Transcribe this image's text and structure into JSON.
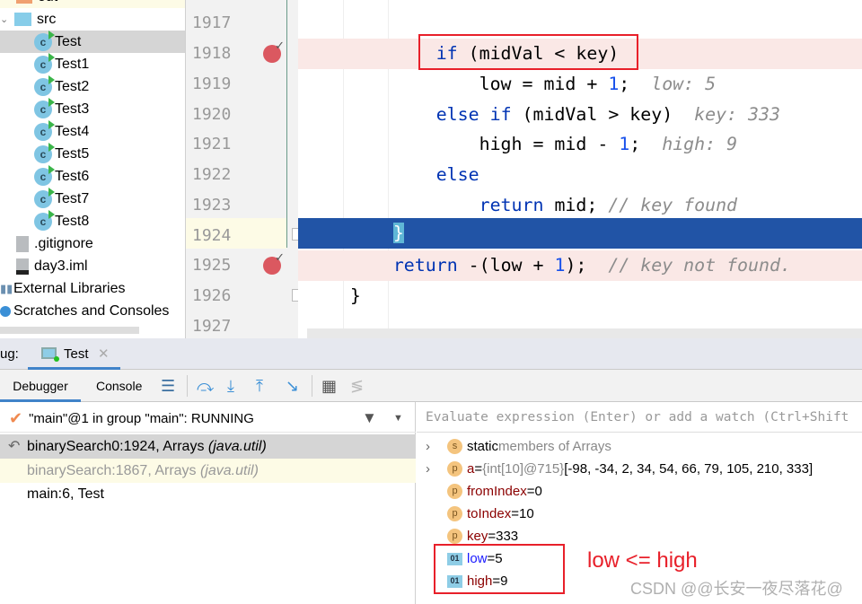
{
  "project_tree": {
    "items": [
      {
        "label": "out",
        "type": "folder"
      },
      {
        "label": "src",
        "type": "folder"
      },
      {
        "label": "Test",
        "type": "class",
        "selected": true
      },
      {
        "label": "Test1",
        "type": "class"
      },
      {
        "label": "Test2",
        "type": "class"
      },
      {
        "label": "Test3",
        "type": "class"
      },
      {
        "label": "Test4",
        "type": "class"
      },
      {
        "label": "Test5",
        "type": "class"
      },
      {
        "label": "Test6",
        "type": "class"
      },
      {
        "label": "Test7",
        "type": "class"
      },
      {
        "label": "Test8",
        "type": "class"
      },
      {
        "label": ".gitignore",
        "type": "file"
      },
      {
        "label": "day3.iml",
        "type": "file"
      },
      {
        "label": "External Libraries",
        "type": "libraries"
      },
      {
        "label": "Scratches and Consoles",
        "type": "scratches"
      }
    ]
  },
  "editor": {
    "line_numbers": [
      "1917",
      "1918",
      "1919",
      "1920",
      "1921",
      "1922",
      "1923",
      "1924",
      "1925",
      "1926",
      "1927"
    ],
    "lines": {
      "l1918": {
        "kw": "if",
        "rest": " (midVal < key)"
      },
      "l1919": {
        "a": "low = mid + ",
        "n": "1",
        "b": ";",
        "hint": "low: 5"
      },
      "l1920": {
        "kw1": "else",
        "kw2": "if",
        "rest": " (midVal > key)",
        "hint": "key: 333"
      },
      "l1921": {
        "a": "high = mid - ",
        "n": "1",
        "b": ";",
        "hint": "high: 9"
      },
      "l1922": {
        "kw": "else"
      },
      "l1923": {
        "kw": "return",
        "rest": " mid; ",
        "comment": "// key found"
      },
      "l1924": {
        "text": "}"
      },
      "l1925": {
        "kw": "return",
        "a": " -(low + ",
        "n": "1",
        "b": ");  ",
        "comment": "// key not found."
      },
      "l1926": {
        "text": "}"
      }
    },
    "breakpoint_color": "#db5860",
    "execution_line_color": "#2154a6"
  },
  "debug": {
    "label": "ug:",
    "tab": "Test",
    "tabs": {
      "debugger": "Debugger",
      "console": "Console"
    },
    "thread": "\"main\"@1 in group \"main\": RUNNING",
    "frames": [
      {
        "method": "binarySearch0:1924, Arrays",
        "pkg": "(java.util)"
      },
      {
        "method": "binarySearch:1867, Arrays",
        "pkg": "(java.util)"
      },
      {
        "method": "main:6, Test",
        "pkg": ""
      }
    ],
    "eval_placeholder": "Evaluate expression (Enter) or add a watch (Ctrl+Shift",
    "variables": [
      {
        "badge": "s",
        "name": "static",
        "value": " members of Arrays"
      },
      {
        "badge": "p",
        "name": "a",
        "eq": " = ",
        "type": "{int[10]@715}",
        "value": " [-98, -34, 2, 34, 54, 66, 79, 105, 210, 333]"
      },
      {
        "badge": "p",
        "name": "fromIndex",
        "eq": " = ",
        "value": "0"
      },
      {
        "badge": "p",
        "name": "toIndex",
        "eq": " = ",
        "value": "10"
      },
      {
        "badge": "p",
        "name": "key",
        "eq": " = ",
        "value": "333"
      },
      {
        "badge": "01",
        "name": "low",
        "eq": " = ",
        "value": "5"
      },
      {
        "badge": "01",
        "name": "high",
        "eq": " = ",
        "value": "9"
      }
    ]
  },
  "annotation": {
    "text": "low <= high",
    "color": "#e8202a"
  },
  "watermark": "CSDN @@长安一夜尽落花@"
}
